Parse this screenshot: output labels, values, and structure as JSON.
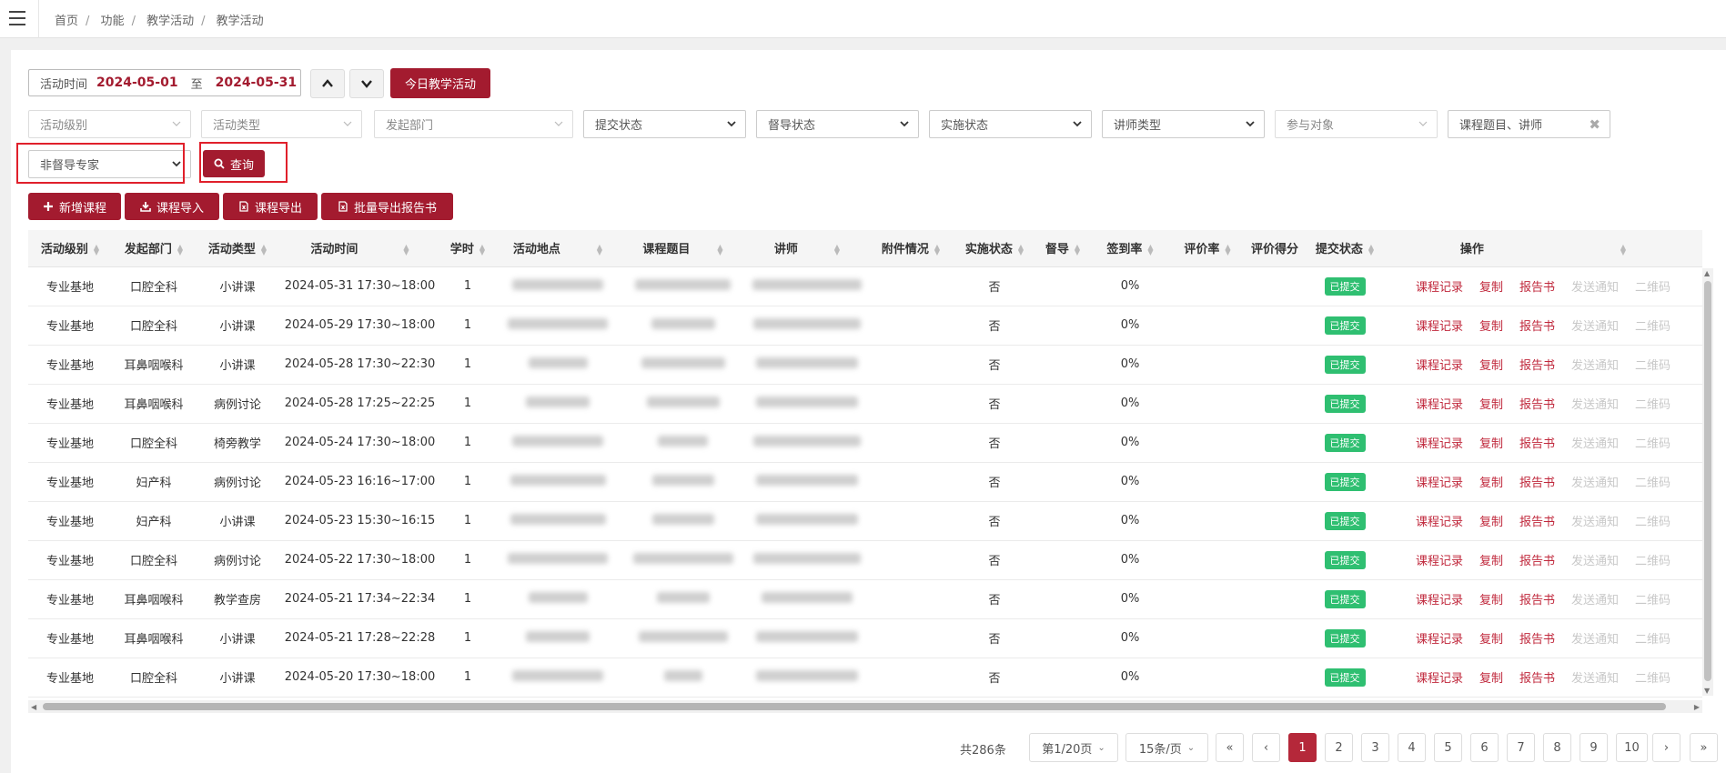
{
  "breadcrumb": [
    "首页",
    "功能",
    "教学活动",
    "教学活动"
  ],
  "date_filter": {
    "label": "活动时间",
    "start": "2024-05-01",
    "to": "至",
    "end": "2024-05-31"
  },
  "today_button": "今日教学活动",
  "filters": [
    "活动级别",
    "活动类型",
    "发起部门",
    "提交状态",
    "督导状态",
    "实施状态",
    "讲师类型",
    "参与对象",
    "课程题目、讲师"
  ],
  "expert_select": "非督导专家",
  "query_button": "查询",
  "actions": [
    "新增课程",
    "课程导入",
    "课程导出",
    "批量导出报告书"
  ],
  "columns": [
    "活动级别",
    "发起部门",
    "活动类型",
    "活动时间",
    "学时",
    "活动地点",
    "课程题目",
    "讲师",
    "附件情况",
    "实施状态",
    "督导",
    "签到率",
    "评价率",
    "评价得分",
    "提交状态",
    "操作"
  ],
  "row_ops": [
    "课程记录",
    "复制",
    "报告书",
    "发送通知",
    "二维码"
  ],
  "rows": [
    {
      "level": "专业基地",
      "dept": "口腔全科",
      "type": "小讲课",
      "time": "2024-05-31 17:30~18:00",
      "hours": "1",
      "impl": "否",
      "sign": "0%",
      "status": "已提交"
    },
    {
      "level": "专业基地",
      "dept": "口腔全科",
      "type": "小讲课",
      "time": "2024-05-29 17:30~18:00",
      "hours": "1",
      "impl": "否",
      "sign": "0%",
      "status": "已提交"
    },
    {
      "level": "专业基地",
      "dept": "耳鼻咽喉科",
      "type": "小讲课",
      "time": "2024-05-28 17:30~22:30",
      "hours": "1",
      "impl": "否",
      "sign": "0%",
      "status": "已提交"
    },
    {
      "level": "专业基地",
      "dept": "耳鼻咽喉科",
      "type": "病例讨论",
      "time": "2024-05-28 17:25~22:25",
      "hours": "1",
      "impl": "否",
      "sign": "0%",
      "status": "已提交"
    },
    {
      "level": "专业基地",
      "dept": "口腔全科",
      "type": "椅旁教学",
      "time": "2024-05-24 17:30~18:00",
      "hours": "1",
      "impl": "否",
      "sign": "0%",
      "status": "已提交"
    },
    {
      "level": "专业基地",
      "dept": "妇产科",
      "type": "病例讨论",
      "time": "2024-05-23 16:16~17:00",
      "hours": "1",
      "impl": "否",
      "sign": "0%",
      "status": "已提交"
    },
    {
      "level": "专业基地",
      "dept": "妇产科",
      "type": "小讲课",
      "time": "2024-05-23 15:30~16:15",
      "hours": "1",
      "impl": "否",
      "sign": "0%",
      "status": "已提交"
    },
    {
      "level": "专业基地",
      "dept": "口腔全科",
      "type": "病例讨论",
      "time": "2024-05-22 17:30~18:00",
      "hours": "1",
      "impl": "否",
      "sign": "0%",
      "status": "已提交"
    },
    {
      "level": "专业基地",
      "dept": "耳鼻咽喉科",
      "type": "教学查房",
      "time": "2024-05-21 17:34~22:34",
      "hours": "1",
      "impl": "否",
      "sign": "0%",
      "status": "已提交"
    },
    {
      "level": "专业基地",
      "dept": "耳鼻咽喉科",
      "type": "小讲课",
      "time": "2024-05-21 17:28~22:28",
      "hours": "1",
      "impl": "否",
      "sign": "0%",
      "status": "已提交"
    },
    {
      "level": "专业基地",
      "dept": "口腔全科",
      "type": "小讲课",
      "time": "2024-05-20 17:30~18:00",
      "hours": "1",
      "impl": "否",
      "sign": "0%",
      "status": "已提交"
    }
  ],
  "pagination": {
    "total": "共286条",
    "page_select": "第1/20页",
    "size_select": "15条/页",
    "first": "«",
    "prev": "‹",
    "next": "›",
    "last": "»",
    "pages": [
      "1",
      "2",
      "3",
      "4",
      "5",
      "6",
      "7",
      "8",
      "9",
      "10"
    ]
  }
}
